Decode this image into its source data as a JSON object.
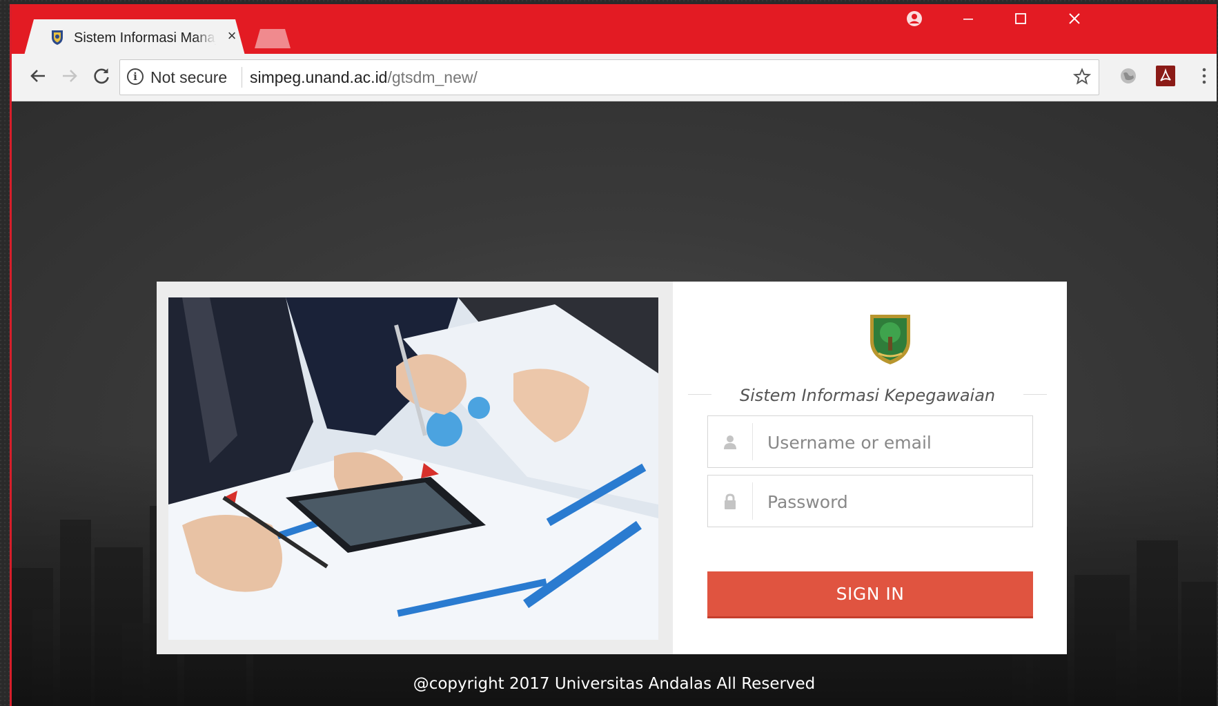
{
  "browser": {
    "tab_title": "Sistem Informasi Manajemen",
    "tab_close": "×",
    "security_label": "Not secure",
    "url_host": "simpeg.unand.ac.id",
    "url_path": "/gtsdm_new/",
    "colors": {
      "titlebar": "#e31b23",
      "newtab": "#f08a8e"
    }
  },
  "login": {
    "subtitle": "Sistem Informasi Kepegawaian",
    "username_placeholder": "Username or email",
    "password_placeholder": "Password",
    "signin_label": "SIGN IN",
    "signin_color": "#e05440"
  },
  "footer": {
    "copyright": "@copyright 2017 Universitas Andalas All Reserved"
  },
  "icons": [
    "shield-favicon-icon",
    "close-icon",
    "profile-icon",
    "minimize-icon",
    "maximize-icon",
    "window-close-icon",
    "back-icon",
    "forward-icon",
    "reload-icon",
    "info-icon",
    "star-icon",
    "extension-icon",
    "pdf-icon",
    "menu-icon",
    "university-logo",
    "user-icon",
    "lock-icon"
  ]
}
